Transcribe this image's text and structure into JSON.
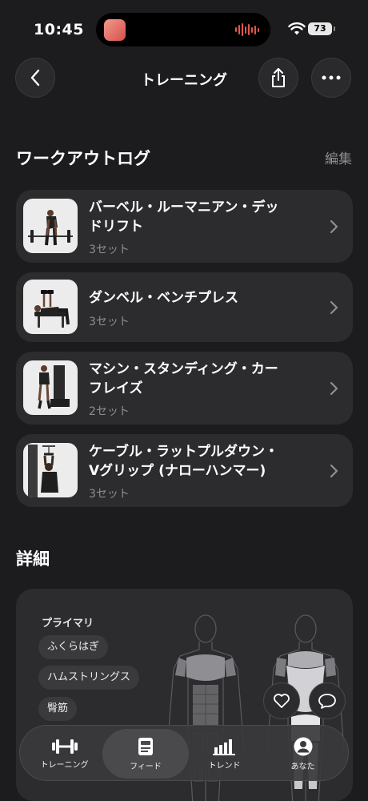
{
  "status_bar": {
    "time": "10:45",
    "battery": "73"
  },
  "nav": {
    "title": "トレーニング"
  },
  "workout_log": {
    "title": "ワークアウトログ",
    "edit_label": "編集",
    "exercises": [
      {
        "name_line1": "バーベル・ルーマニアン・デッ",
        "name_line2": "ドリフト",
        "sets": "3セット"
      },
      {
        "name_line1": "ダンベル・ベンチプレス",
        "name_line2": "",
        "sets": "3セット"
      },
      {
        "name_line1": "マシン・スタンディング・カー",
        "name_line2": "フレイズ",
        "sets": "2セット"
      },
      {
        "name_line1": "ケーブル・ラットプルダウン・",
        "name_line2": "Vグリップ (ナローハンマー)",
        "sets": "3セット"
      }
    ]
  },
  "details": {
    "title": "詳細",
    "primary_label": "プライマリ",
    "muscles": [
      "ふくらはぎ",
      "ハムストリングス",
      "臀筋"
    ]
  },
  "tabbar": {
    "tabs": [
      {
        "label": "トレーニング",
        "icon": "dumbbell-icon"
      },
      {
        "label": "フィード",
        "icon": "feed-icon"
      },
      {
        "label": "トレンド",
        "icon": "chart-icon"
      },
      {
        "label": "あなた",
        "icon": "person-icon"
      }
    ],
    "active": "フィード"
  },
  "colors": {
    "background": "#1c1c1e",
    "card": "#2c2c2e",
    "secondary_text": "#8e8e93"
  }
}
